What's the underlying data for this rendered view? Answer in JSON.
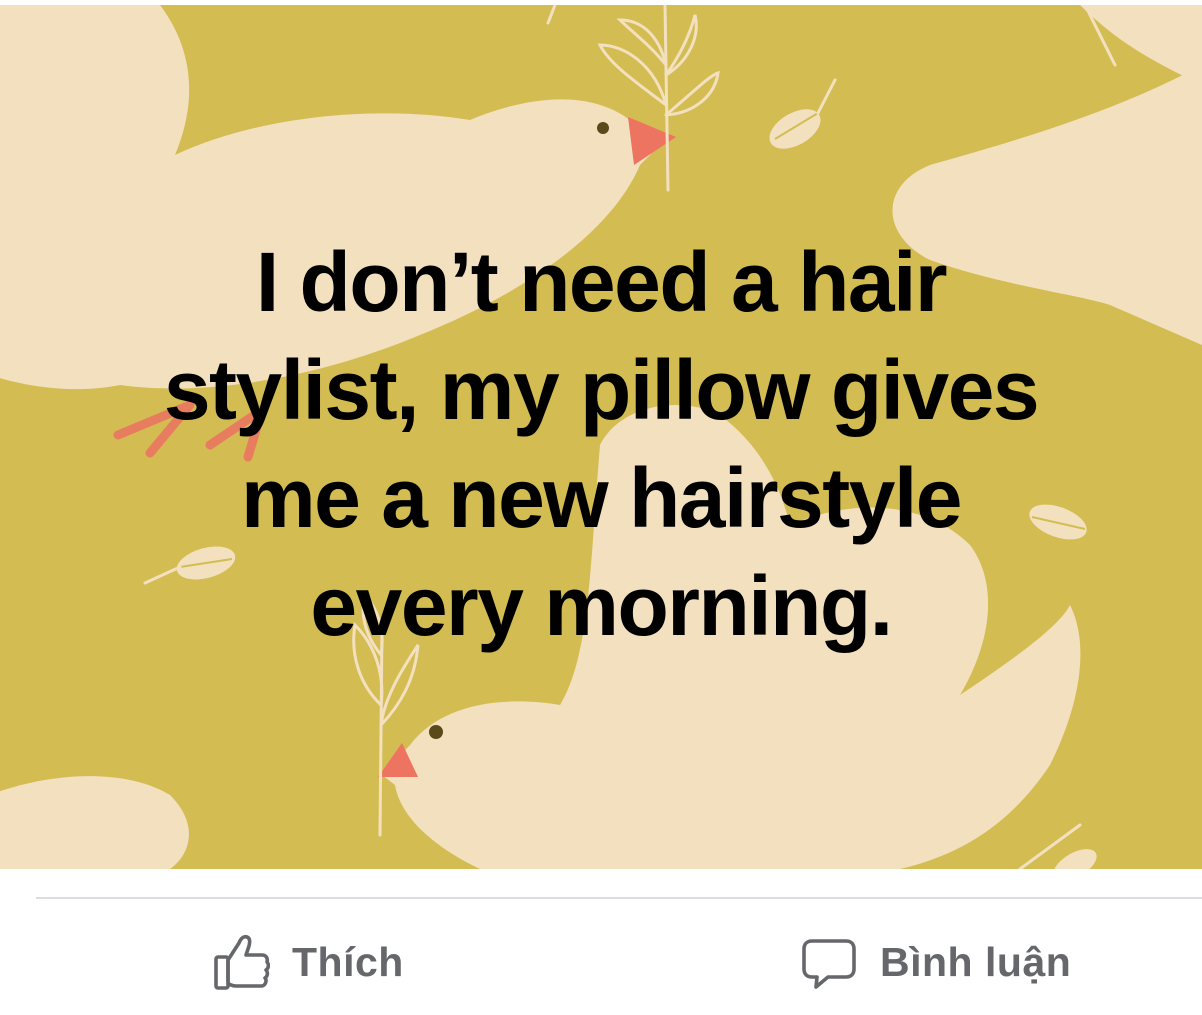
{
  "post": {
    "text_lines": [
      "I don’t need a hair",
      "stylist, my pillow gives",
      "me a new hairstyle",
      "every morning."
    ],
    "background": {
      "color": "#d3bd52",
      "motif": "cream doves carrying olive branches"
    }
  },
  "actions": {
    "like": {
      "label": "Thích",
      "icon": "thumbs-up-icon"
    },
    "comment": {
      "label": "Bình luận",
      "icon": "comment-bubble-icon"
    }
  },
  "colors": {
    "text": "#000000",
    "action_text": "#65676b",
    "divider": "#dadde1",
    "dove": "#f3e0bf",
    "beak": "#ec7461",
    "eye": "#5a4a1a"
  }
}
